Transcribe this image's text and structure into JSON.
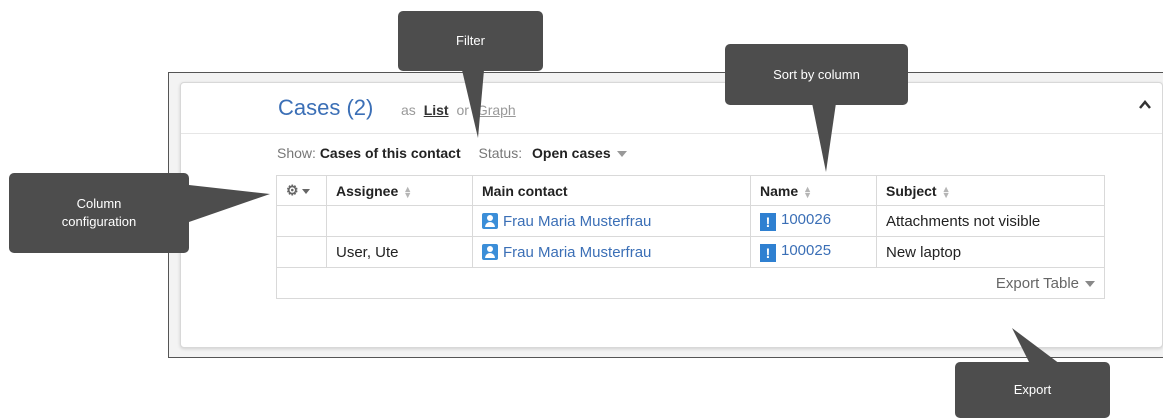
{
  "panel": {
    "title": "Cases (2)",
    "as_label": "as",
    "view_list": "List",
    "view_or": "or",
    "view_graph": "Graph"
  },
  "filter": {
    "show_label": "Show:",
    "show_value": "Cases of this contact",
    "status_label": "Status:",
    "status_value": "Open cases"
  },
  "table": {
    "columns": [
      "Assignee",
      "Main contact",
      "Name",
      "Subject"
    ],
    "rows": [
      {
        "assignee": "",
        "main_contact": "Frau Maria Musterfrau",
        "name": "100026",
        "subject": "Attachments not visible"
      },
      {
        "assignee": "User, Ute",
        "main_contact": "Frau Maria Musterfrau",
        "name": "100025",
        "subject": "New laptop"
      }
    ],
    "case_icon_glyph": "!",
    "export_label": "Export Table"
  },
  "callouts": {
    "filter": "Filter",
    "sort": "Sort by column",
    "column_config_line1": "Column",
    "column_config_line2": "configuration",
    "export": "Export"
  },
  "colors": {
    "accent": "#3b6fb6",
    "callout_bg": "#4d4d4d",
    "icon_blue": "#2f80d1"
  }
}
